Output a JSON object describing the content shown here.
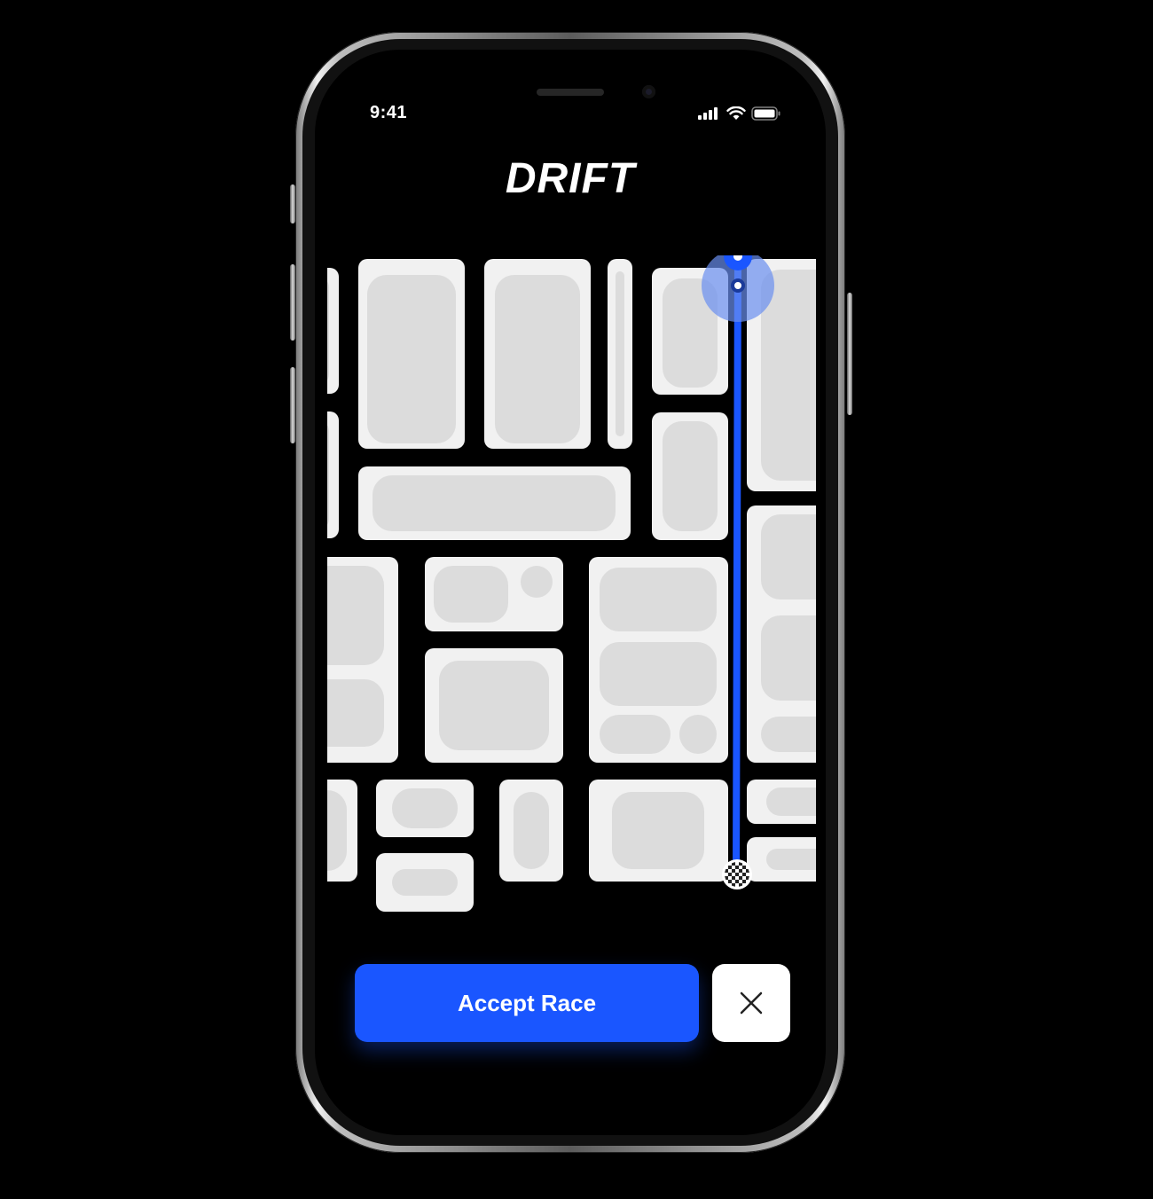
{
  "status_bar": {
    "time": "9:41"
  },
  "app": {
    "brand": "DRIFT"
  },
  "actions": {
    "accept_label": "Accept Race",
    "close_icon": "close-icon"
  },
  "colors": {
    "accent": "#1A56FF",
    "block": "#F1F1F1",
    "block_inner": "#DCDCDC",
    "background": "#000000"
  }
}
